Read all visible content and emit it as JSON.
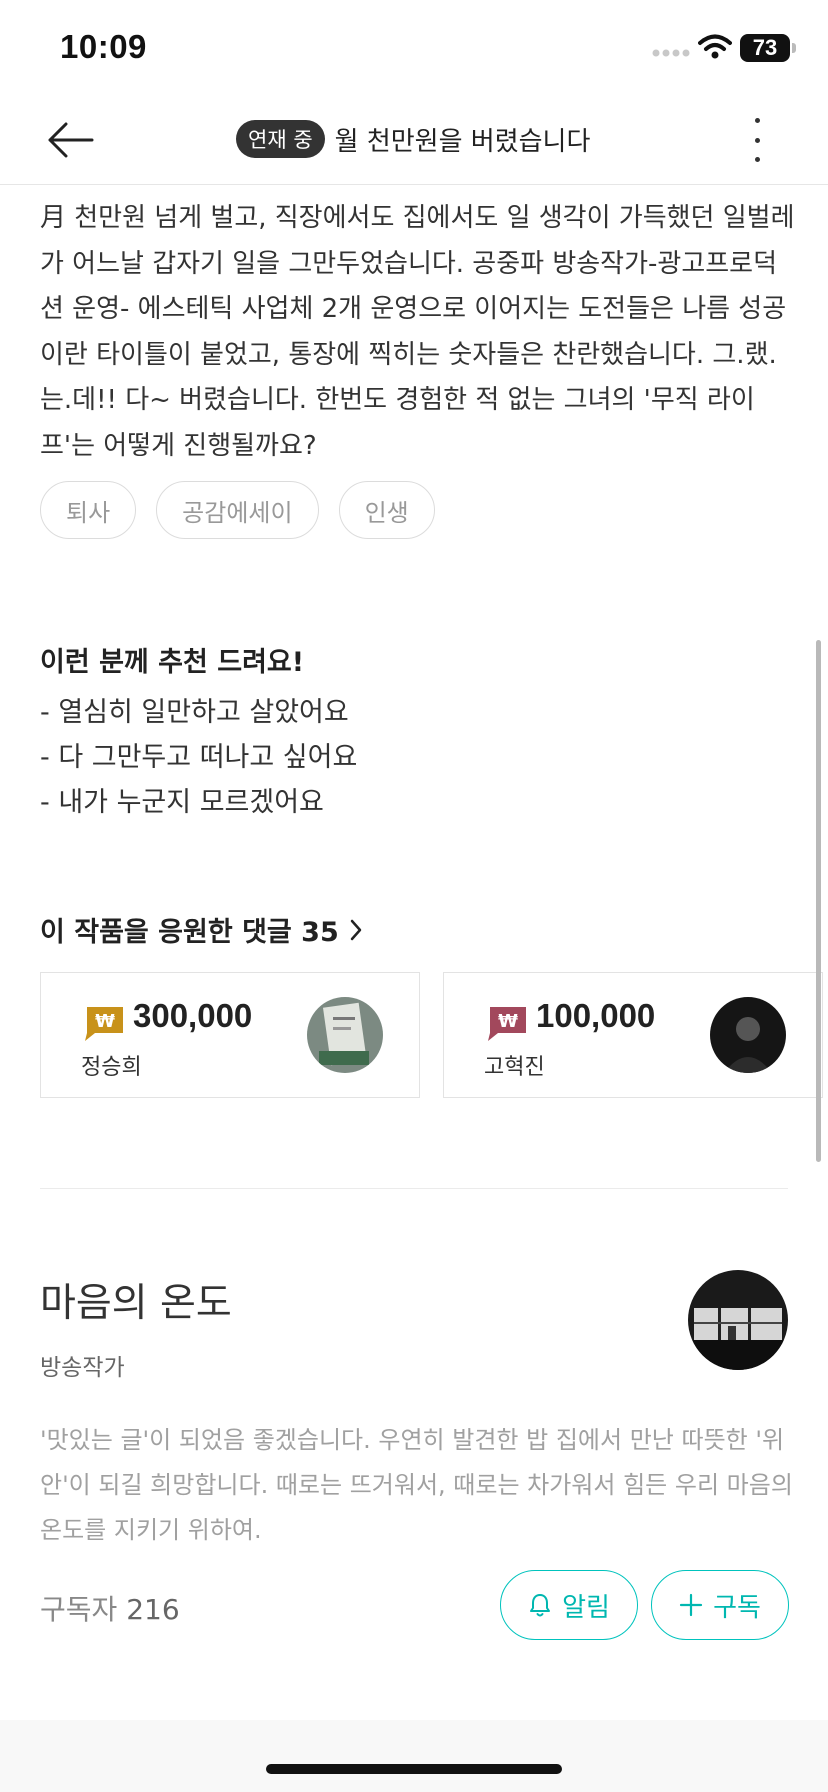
{
  "status_bar": {
    "time": "10:09",
    "battery": "73"
  },
  "header": {
    "badge": "연재 중",
    "title": "월 천만원을 버렸습니다"
  },
  "description": "月 천만원 넘게 벌고,  직장에서도 집에서도 일 생각이 가득했던 일벌레가 어느날 갑자기 일을 그만두었습니다. 공중파 방송작가-광고프로덕션 운영- 에스테틱 사업체 2개 운영으로 이어지는 도전들은 나름 성공이란 타이틀이 붙었고, 통장에 찍히는 숫자들은 찬란했습니다. 그.랬.는.데!! 다~ 버렸습니다. 한번도 경험한 적 없는 그녀의 '무직 라이프'는 어떻게 진행될까요?",
  "tags": [
    "퇴사",
    "공감에세이",
    "인생"
  ],
  "recommend": {
    "title": "이런 분께 추천 드려요!",
    "items": [
      "- 열심히 일만하고 살았어요",
      "- 다 그만두고 떠나고 싶어요",
      "- 내가 누군지 모르겠어요"
    ]
  },
  "comments": {
    "title": "이 작품을 응원한 댓글 35",
    "cards": [
      {
        "amount": "300,000",
        "name": "정승희",
        "icon_color": "#c8921a"
      },
      {
        "amount": "100,000",
        "name": "고혁진",
        "icon_color": "#a2485c"
      }
    ]
  },
  "author": {
    "name": "마음의 온도",
    "role": "방송작가",
    "bio": "'맛있는 글'이 되었음 좋겠습니다. 우연히 발견한 밥 집에서 만난 따뜻한 '위안'이 되길 희망합니다. 때로는 뜨거워서, 때로는 차가워서 힘든 우리 마음의 온도를 지키기 위하여.",
    "subscribers_label": "구독자",
    "subscribers_count": "216"
  },
  "buttons": {
    "alarm": "알림",
    "subscribe": "구독"
  },
  "colors": {
    "accent": "#00c3bd",
    "badge_bg": "#333333"
  }
}
